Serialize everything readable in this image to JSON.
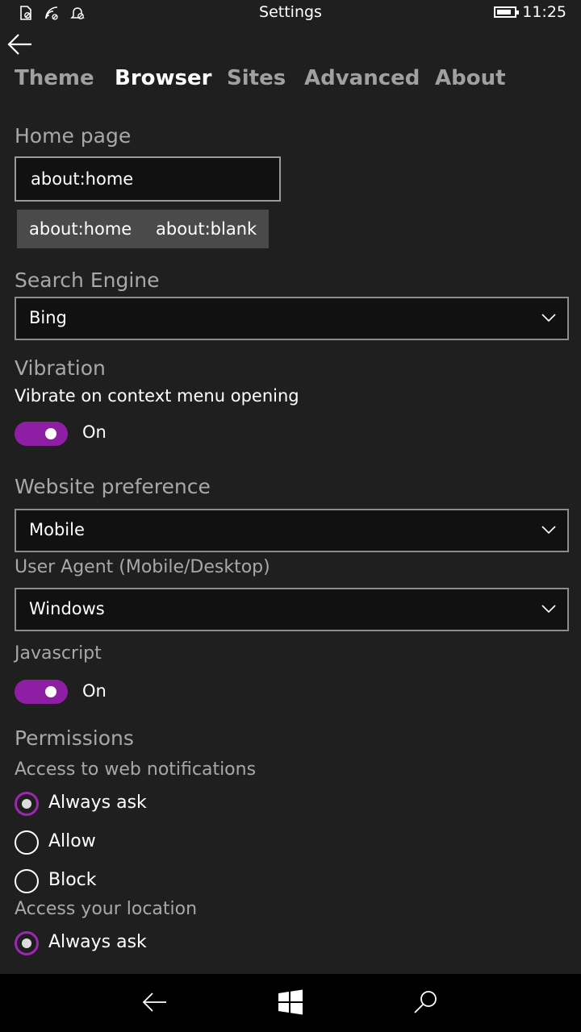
{
  "status_bar": {
    "title": "Settings",
    "time": "11:25",
    "battery_level": 0.85
  },
  "tabs": [
    {
      "label": "Theme",
      "active": false
    },
    {
      "label": "Browser",
      "active": true
    },
    {
      "label": "Sites",
      "active": false
    },
    {
      "label": "Advanced",
      "active": false
    },
    {
      "label": "About",
      "active": false
    }
  ],
  "home_page": {
    "header": "Home page",
    "value": "about:home",
    "quick_buttons": [
      "about:home",
      "about:blank"
    ]
  },
  "search_engine": {
    "header": "Search Engine",
    "selected": "Bing"
  },
  "vibration": {
    "header": "Vibration",
    "description": "Vibrate on context menu opening",
    "toggle_label": "On",
    "on": true
  },
  "website_preference": {
    "header": "Website preference",
    "selected": "Mobile"
  },
  "user_agent": {
    "label": "User Agent (Mobile/Desktop)",
    "selected": "Windows"
  },
  "javascript": {
    "label": "Javascript",
    "toggle_label": "On",
    "on": true
  },
  "permissions": {
    "header": "Permissions",
    "notifications": {
      "label": "Access to web notifications",
      "options": [
        "Always ask",
        "Allow",
        "Block"
      ],
      "selected": "Always ask"
    },
    "location": {
      "label": "Access your location",
      "options": [
        "Always ask"
      ],
      "selected": "Always ask"
    }
  },
  "icons": {
    "status_left": [
      "no-sim-icon",
      "wifi-icon",
      "quiet-hours-icon"
    ],
    "nav": [
      "back-icon",
      "windows-start-icon",
      "search-icon"
    ]
  },
  "colors": {
    "background": "#1f1f1f",
    "accent": "#8e1fa5",
    "nav_bar": "#000000"
  }
}
